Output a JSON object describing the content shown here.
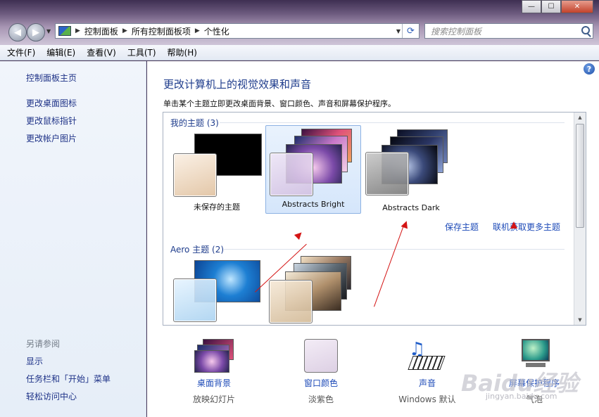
{
  "window": {
    "caption_min": "—",
    "caption_max": "☐",
    "caption_close": "✕"
  },
  "nav": {
    "back_glyph": "◀",
    "forward_glyph": "▶",
    "breadcrumb": [
      "控制面板",
      "所有控制面板项",
      "个性化"
    ],
    "refresh_glyph": "⟳",
    "search_placeholder": "搜索控制面板"
  },
  "menu": [
    "文件(F)",
    "编辑(E)",
    "查看(V)",
    "工具(T)",
    "帮助(H)"
  ],
  "sidebar": {
    "home": "控制面板主页",
    "links": [
      "更改桌面图标",
      "更改鼠标指针",
      "更改帐户图片"
    ],
    "see_also_title": "另请参阅",
    "see_also": [
      "显示",
      "任务栏和「开始」菜单",
      "轻松访问中心"
    ]
  },
  "main": {
    "title": "更改计算机上的视觉效果和声音",
    "subtitle": "单击某个主题立即更改桌面背景、窗口颜色、声音和屏幕保护程序。",
    "my_themes_title": "我的主题 (3)",
    "my_themes": [
      "未保存的主题",
      "Abstracts Bright",
      "Abstracts Dark"
    ],
    "selected_theme": "Abstracts Bright",
    "save_theme": "保存主题",
    "get_more_online": "联机获取更多主题",
    "aero_title": "Aero 主题 (2)"
  },
  "options": [
    {
      "label": "桌面背景",
      "value": "放映幻灯片",
      "icon": "desktop-background-icon"
    },
    {
      "label": "窗口颜色",
      "value": "淡紫色",
      "icon": "window-color-icon"
    },
    {
      "label": "声音",
      "value": "Windows 默认",
      "icon": "sound-icon"
    },
    {
      "label": "屏幕保护程序",
      "value": "气泡",
      "icon": "screensaver-icon"
    }
  ],
  "watermark": {
    "text": "Baidu经验",
    "sub": "jingyan.baidu.com"
  },
  "colors": {
    "link": "#1e4bb8",
    "title": "#1e3c8c",
    "annotation_arrow": "#d41414"
  }
}
